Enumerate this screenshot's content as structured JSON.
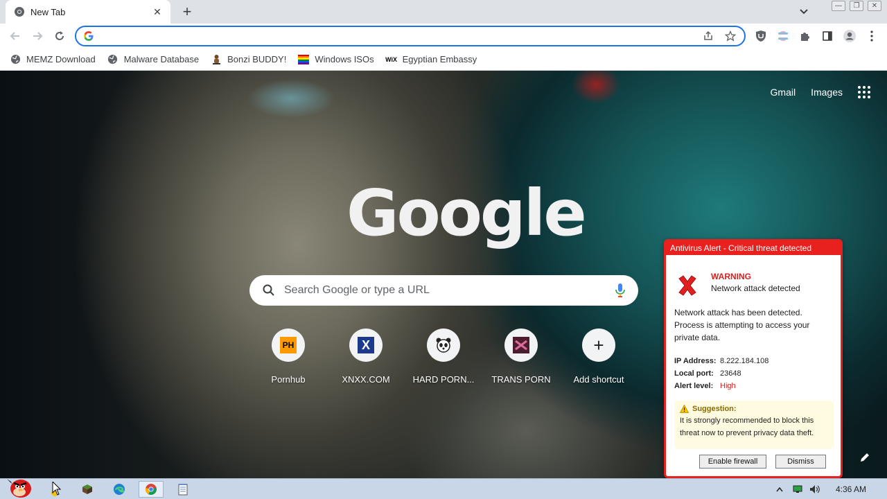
{
  "browser": {
    "tab_title": "New Tab",
    "omnibox_value": ""
  },
  "bookmarks": [
    {
      "label": "MEMZ Download",
      "icon": "globe-icon"
    },
    {
      "label": "Malware Database",
      "icon": "globe-icon"
    },
    {
      "label": "Bonzi BUDDY!",
      "icon": "bonzi-icon"
    },
    {
      "label": "Windows ISOs",
      "icon": "rainbow-icon"
    },
    {
      "label": "Egyptian Embassy",
      "icon": "wix-icon"
    }
  ],
  "ntp": {
    "gmail_label": "Gmail",
    "images_label": "Images",
    "logo_text": "Google",
    "search_placeholder": "Search Google or type a URL",
    "shortcuts": [
      {
        "label": "Pornhub",
        "glyph": "PH"
      },
      {
        "label": "XNXX.COM",
        "glyph": "X"
      },
      {
        "label": "HARD PORN...",
        "glyph": "🐼"
      },
      {
        "label": "TRANS PORN",
        "glyph": ""
      },
      {
        "label": "Add shortcut",
        "glyph": "+"
      }
    ]
  },
  "alert": {
    "title": "Antivirus Alert - Critical threat detected",
    "warning": "WARNING",
    "subtitle": "Network attack detected",
    "body": "Network attack has been detected. Process is attempting to access your private data.",
    "ip_label": "IP Address:",
    "ip_value": "8.222.184.108",
    "port_label": "Local port:",
    "port_value": "23648",
    "level_label": "Alert level:",
    "level_value": "High",
    "suggestion_label": "Suggestion:",
    "suggestion_text": "It is strongly recommended to block this threat now to prevent privacy data theft.",
    "enable_label": "Enable firewall",
    "dismiss_label": "Dismiss"
  },
  "taskbar": {
    "clock": "4:36 AM"
  },
  "colors": {
    "alert_red": "#e8201e",
    "omnibox_border": "#1a73e8"
  }
}
